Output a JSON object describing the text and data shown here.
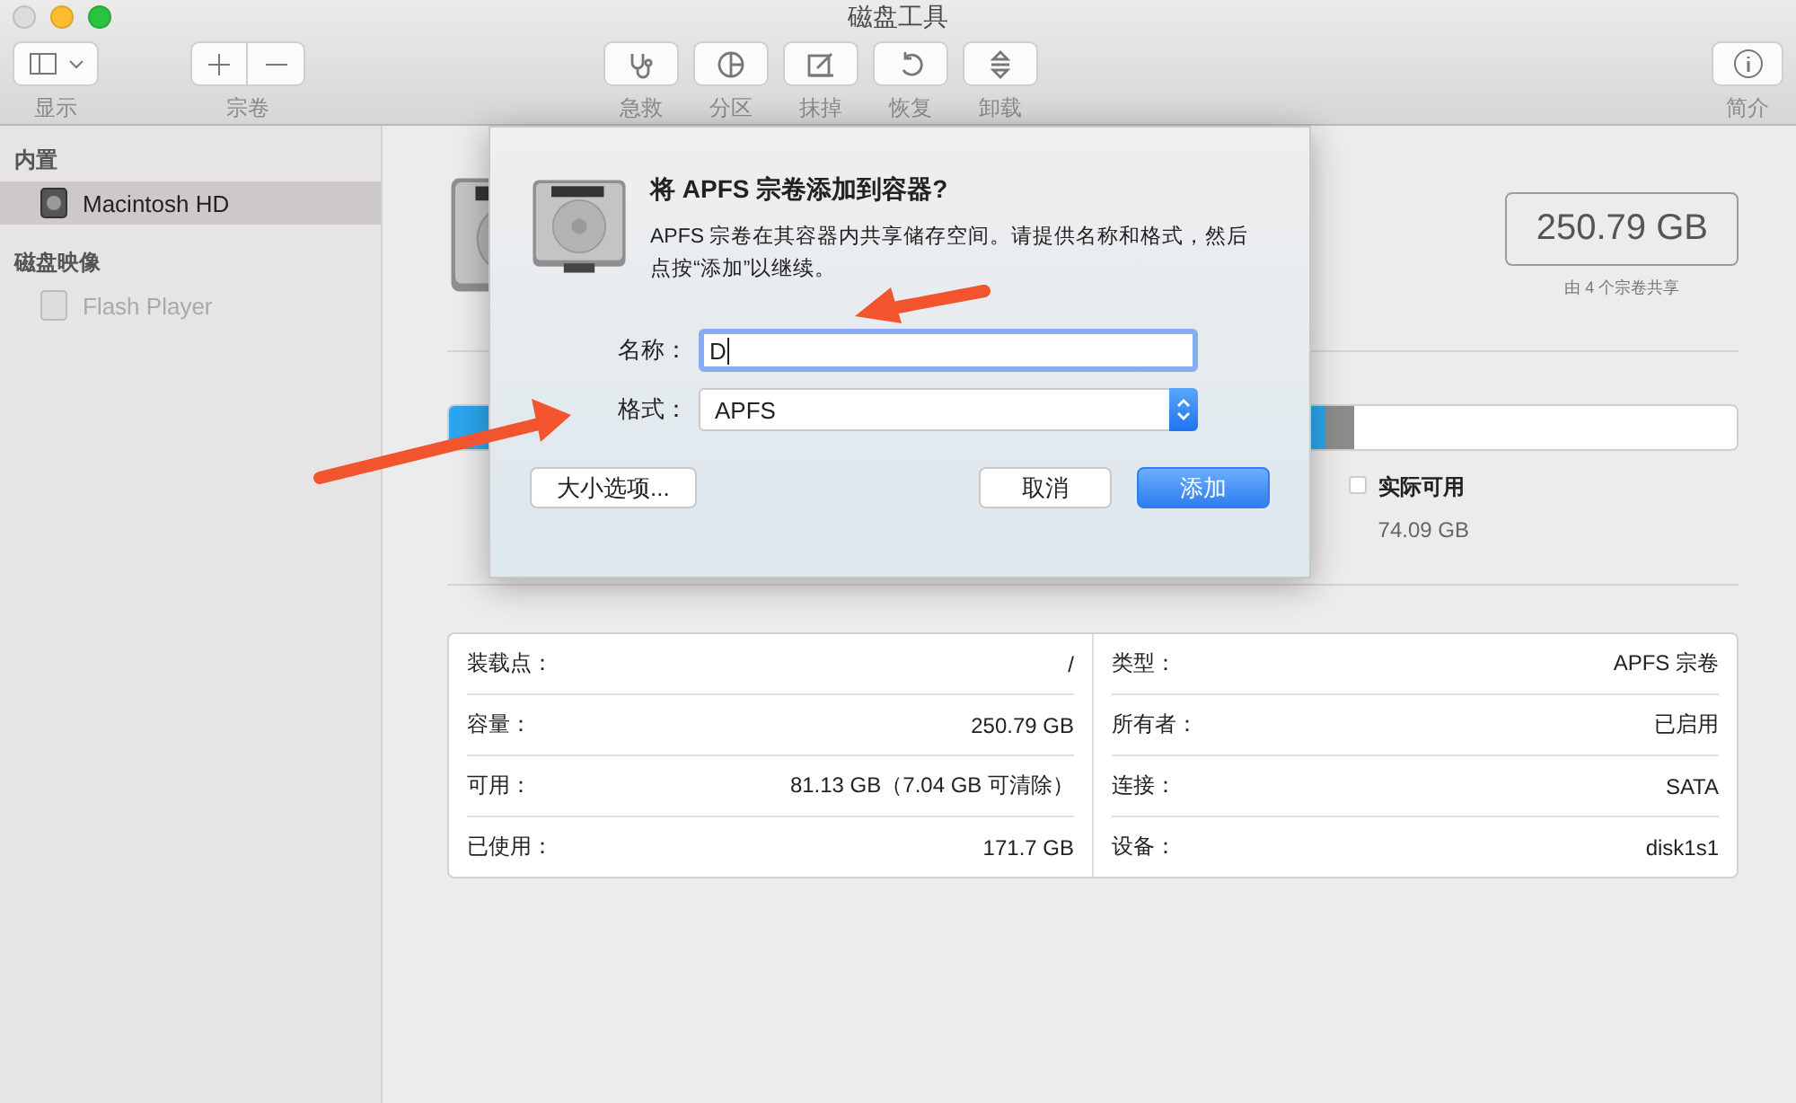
{
  "window": {
    "title": "磁盘工具"
  },
  "toolbar": {
    "groups": [
      {
        "label": "显示",
        "kind": "view"
      },
      {
        "label": "宗卷",
        "kind": "volume"
      }
    ],
    "actions": [
      {
        "label": "急救",
        "kind": "firstaid"
      },
      {
        "label": "分区",
        "kind": "partition"
      },
      {
        "label": "抹掉",
        "kind": "erase"
      },
      {
        "label": "恢复",
        "kind": "restore"
      },
      {
        "label": "卸载",
        "kind": "unmount"
      }
    ],
    "info": {
      "label": "简介"
    }
  },
  "sidebar": {
    "sections": [
      {
        "title": "内置",
        "items": [
          {
            "label": "Macintosh HD",
            "selected": true,
            "disabled": false
          }
        ]
      },
      {
        "title": "磁盘映像",
        "items": [
          {
            "label": "Flash Player",
            "selected": false,
            "disabled": true
          }
        ]
      }
    ]
  },
  "capacity": {
    "value": "250.79 GB",
    "caption": "由 4 个宗卷共享"
  },
  "usage": {
    "segments": [
      {
        "level": 0.68,
        "color": "#2ba6ee"
      }
    ],
    "legend": [
      {
        "label": "实际可用",
        "value": "74.09 GB",
        "color": "#ffffff"
      }
    ]
  },
  "info": {
    "left": [
      {
        "label": "装载点：",
        "value": "/"
      },
      {
        "label": "容量：",
        "value": "250.79 GB"
      },
      {
        "label": "可用：",
        "value": "81.13 GB（7.04 GB 可清除）"
      },
      {
        "label": "已使用：",
        "value": "171.7 GB"
      }
    ],
    "right": [
      {
        "label": "类型：",
        "value": "APFS 宗卷"
      },
      {
        "label": "所有者：",
        "value": "已启用"
      },
      {
        "label": "连接：",
        "value": "SATA"
      },
      {
        "label": "设备：",
        "value": "disk1s1"
      }
    ]
  },
  "dialog": {
    "title": "将 APFS 宗卷添加到容器?",
    "message": "APFS 宗卷在其容器内共享储存空间。请提供名称和格式，然后点按“添加”以继续。",
    "fields": [
      {
        "label": "名称：",
        "value": "D",
        "kind": "text"
      },
      {
        "label": "格式：",
        "value": "APFS",
        "kind": "select"
      }
    ],
    "buttons": [
      {
        "label": "大小选项...",
        "kind": "secondary"
      },
      {
        "label": "取消",
        "kind": "secondary"
      },
      {
        "label": "添加",
        "kind": "primary"
      }
    ]
  },
  "annotations": [
    {
      "kind": "arrow"
    },
    {
      "kind": "arrow"
    }
  ]
}
